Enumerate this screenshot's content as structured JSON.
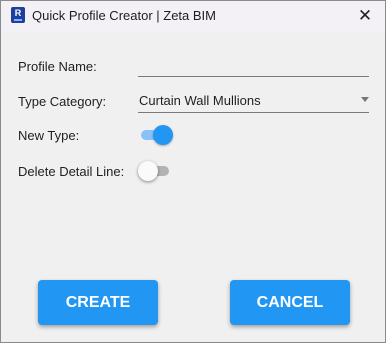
{
  "window": {
    "title": "Quick Profile Creator | Zeta BIM",
    "app_icon_letter": "R",
    "close_glyph": "✕"
  },
  "form": {
    "profile_name": {
      "label": "Profile Name:",
      "value": ""
    },
    "type_category": {
      "label": "Type Category:",
      "value": "Curtain Wall Mullions"
    },
    "new_type": {
      "label": "New Type:",
      "checked": true
    },
    "delete_detail_line": {
      "label": "Delete Detail Line:",
      "checked": false
    }
  },
  "buttons": {
    "create_label": "CREATE",
    "cancel_label": "CANCEL"
  },
  "colors": {
    "accent": "#2196f3",
    "titlebar_bg": "#f4f1f6",
    "body_bg": "#f0f0f0"
  },
  "icons": {
    "app": "revit-app-icon",
    "close": "close-icon",
    "dropdown": "chevron-down-icon"
  }
}
